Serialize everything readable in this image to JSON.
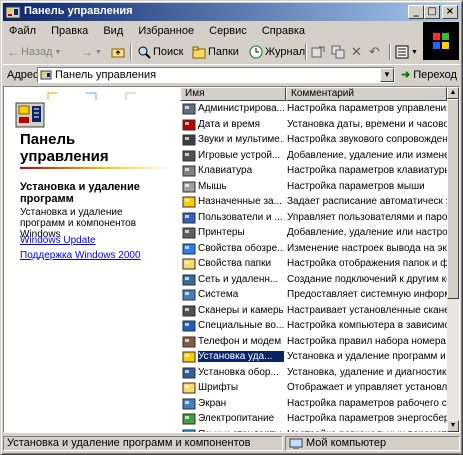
{
  "window": {
    "title": "Панель управления"
  },
  "menu": [
    "Файл",
    "Правка",
    "Вид",
    "Избранное",
    "Сервис",
    "Справка"
  ],
  "toolbar": {
    "back": "Назад",
    "search": "Поиск",
    "folders": "Папки",
    "history": "Журнал"
  },
  "address": {
    "label": "Адрес",
    "value": "Панель управления",
    "go": "Переход"
  },
  "left_pane": {
    "title": "Панель управления",
    "selected_title": "Установка и удаление программ",
    "selected_desc": "Установка и удаление программ и компонентов Windows",
    "links": [
      "Windows Update",
      "Поддержка Windows 2000"
    ]
  },
  "columns": [
    "Имя",
    "Комментарий"
  ],
  "items": [
    {
      "name": "Администрирова...",
      "desc": "Настройка параметров управления к",
      "icon": "admin-tools-icon"
    },
    {
      "name": "Дата и время",
      "desc": "Установка даты, времени и часового",
      "icon": "date-time-icon"
    },
    {
      "name": "Звуки и мультиме...",
      "desc": "Настройка звукового сопровождения",
      "icon": "sounds-icon"
    },
    {
      "name": "Игровые устрой...",
      "desc": "Добавление, удаление или изменен",
      "icon": "game-controllers-icon"
    },
    {
      "name": "Клавиатура",
      "desc": "Настройка параметров клавиатуры",
      "icon": "keyboard-icon"
    },
    {
      "name": "Мышь",
      "desc": "Настройка параметров мыши",
      "icon": "mouse-icon"
    },
    {
      "name": "Назначенные за...",
      "desc": "Задает расписание автоматическ з",
      "icon": "scheduled-tasks-icon"
    },
    {
      "name": "Пользователи и ...",
      "desc": "Управляет пользователями и пароля",
      "icon": "users-icon"
    },
    {
      "name": "Принтеры",
      "desc": "Добавление, удаление или настройк",
      "icon": "printers-icon"
    },
    {
      "name": "Свойства обозре...",
      "desc": "Изменение настроек вывода на экра",
      "icon": "internet-options-icon"
    },
    {
      "name": "Свойства папки",
      "desc": "Настройка отображения папок и фай",
      "icon": "folder-options-icon"
    },
    {
      "name": "Сеть и удаленн...",
      "desc": "Создание подключений к другим ко",
      "icon": "network-icon"
    },
    {
      "name": "Система",
      "desc": "Предоставляет системную информа",
      "icon": "system-icon"
    },
    {
      "name": "Сканеры и камеры",
      "desc": "Настраивает установленные сканер",
      "icon": "scanners-icon"
    },
    {
      "name": "Специальные во...",
      "desc": "Настройка компьютера в зависимо",
      "icon": "accessibility-icon"
    },
    {
      "name": "Телефон и модем",
      "desc": "Настройка правил набора номера и",
      "icon": "phone-modem-icon"
    },
    {
      "name": "Установка уда...",
      "desc": "Установка и удаление программ и",
      "icon": "add-remove-programs-icon",
      "selected": true
    },
    {
      "name": "Установка обор...",
      "desc": "Установка, удаление и диагностика",
      "icon": "add-hardware-icon"
    },
    {
      "name": "Шрифты",
      "desc": "Отображает и управляет установле",
      "icon": "fonts-icon"
    },
    {
      "name": "Экран",
      "desc": "Настройка параметров рабочего сто",
      "icon": "display-icon"
    },
    {
      "name": "Электропитание",
      "desc": "Настройка параметров энергосбереж",
      "icon": "power-options-icon"
    },
    {
      "name": "Язык и стандарты",
      "desc": "Настройка региональных параметров",
      "icon": "regional-options-icon"
    }
  ],
  "status": {
    "text": "Установка и удаление программ и компонентов",
    "zone": "Мой компьютер"
  }
}
